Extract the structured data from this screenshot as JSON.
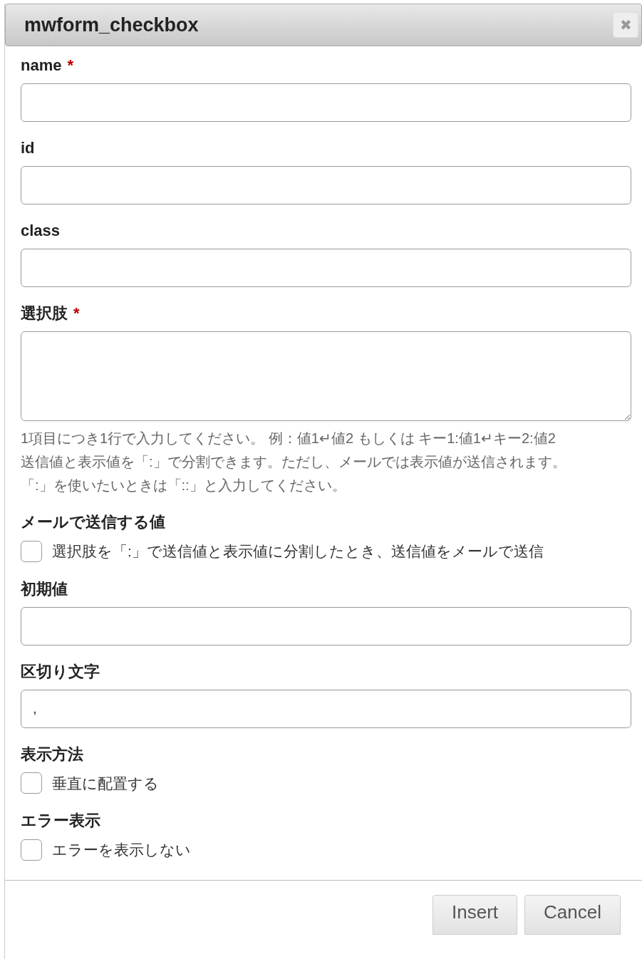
{
  "window": {
    "title": "mwform_checkbox",
    "close": "✖"
  },
  "fields": [
    {
      "kind": "text",
      "label": "name",
      "required_mark": "*"
    },
    {
      "kind": "text",
      "label": "id"
    },
    {
      "kind": "text",
      "label": "class"
    },
    {
      "kind": "textarea",
      "label": "選択肢",
      "required_mark": "*",
      "help": [
        "1項目につき1行で入力してください。 例：値1↵値2 もしくは キー1:値1↵キー2:値2",
        "送信値と表示値を「:」で分割できます。ただし、メールでは表示値が送信されます。",
        "「:」を使いたいときは「::」と入力してください。"
      ]
    },
    {
      "kind": "checkbox",
      "label": "メールで送信する値",
      "option": "選択肢を「:」で送信値と表示値に分割したとき、送信値をメールで送信",
      "checked": false
    },
    {
      "kind": "text",
      "label": "初期値"
    },
    {
      "kind": "text",
      "label": "区切り文字",
      "value": ","
    },
    {
      "kind": "checkbox",
      "label": "表示方法",
      "option": "垂直に配置する",
      "checked": false
    },
    {
      "kind": "checkbox",
      "label": "エラー表示",
      "option": "エラーを表示しない",
      "checked": false
    }
  ],
  "buttons": [
    "Insert",
    "Cancel"
  ]
}
